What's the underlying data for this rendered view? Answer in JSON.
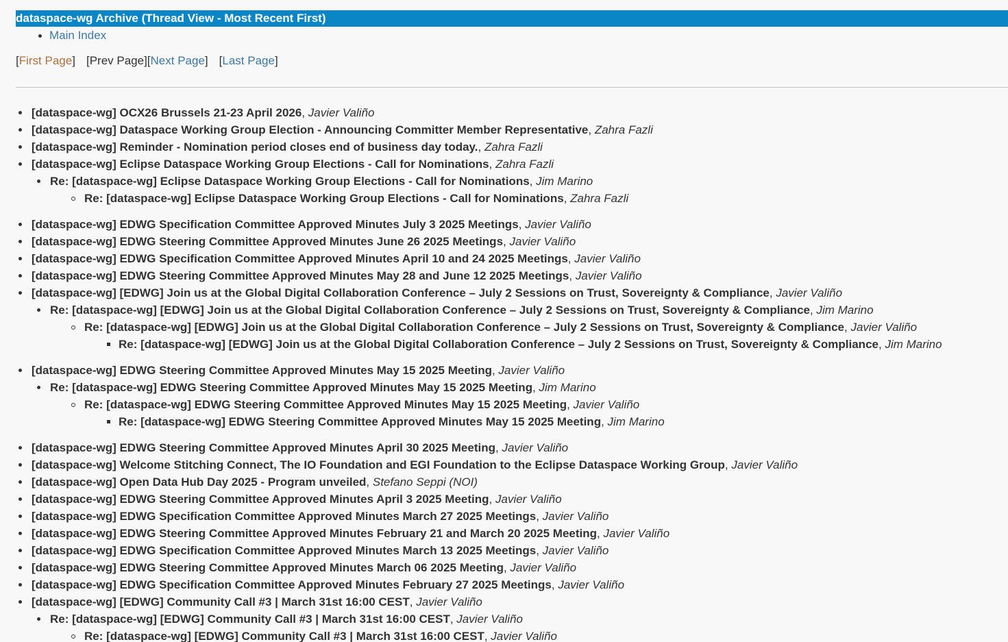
{
  "header": {
    "title": "dataspace-wg Archive (Thread View - Most Recent First)"
  },
  "nav": {
    "main_index": "Main Index"
  },
  "pager": {
    "first": "First Page",
    "prev": "Prev Page",
    "next": "Next Page",
    "last": "Last Page"
  },
  "threads": [
    {
      "depth": 0,
      "gap": false,
      "subject": "[dataspace-wg] OCX26 Brussels 21-23 April 2026",
      "author": "Javier Valiño"
    },
    {
      "depth": 0,
      "gap": false,
      "subject": "[dataspace-wg] Dataspace Working Group Election - Announcing Committer Member Representative",
      "author": "Zahra Fazli"
    },
    {
      "depth": 0,
      "gap": false,
      "subject": "[dataspace-wg] Reminder - Nomination period closes end of business day today.",
      "author": "Zahra Fazli"
    },
    {
      "depth": 0,
      "gap": false,
      "subject": "[dataspace-wg] Eclipse Dataspace Working Group Elections - Call for Nominations",
      "author": "Zahra Fazli"
    },
    {
      "depth": 1,
      "gap": false,
      "subject": "Re: [dataspace-wg] Eclipse Dataspace Working Group Elections - Call for Nominations",
      "author": "Jim Marino"
    },
    {
      "depth": 2,
      "gap": false,
      "subject": "Re: [dataspace-wg] Eclipse Dataspace Working Group Elections - Call for Nominations",
      "author": "Zahra Fazli"
    },
    {
      "depth": 0,
      "gap": true,
      "subject": "[dataspace-wg] EDWG Specification Committee Approved Minutes July 3 2025 Meetings",
      "author": "Javier Valiño"
    },
    {
      "depth": 0,
      "gap": false,
      "subject": "[dataspace-wg] EDWG Steering Committee Approved Minutes June 26 2025 Meetings",
      "author": "Javier Valiño"
    },
    {
      "depth": 0,
      "gap": false,
      "subject": "[dataspace-wg] EDWG Specification Committee Approved Minutes April 10 and 24 2025 Meetings",
      "author": "Javier Valiño"
    },
    {
      "depth": 0,
      "gap": false,
      "subject": "[dataspace-wg] EDWG Steering Committee Approved Minutes May 28 and June 12 2025 Meetings",
      "author": "Javier Valiño"
    },
    {
      "depth": 0,
      "gap": false,
      "subject": "[dataspace-wg] [EDWG] Join us at the Global Digital Collaboration Conference – July 2 Sessions on Trust, Sovereignty & Compliance",
      "author": "Javier Valiño"
    },
    {
      "depth": 1,
      "gap": false,
      "subject": "Re: [dataspace-wg] [EDWG] Join us at the Global Digital Collaboration Conference – July 2 Sessions on Trust, Sovereignty & Compliance",
      "author": "Jim Marino"
    },
    {
      "depth": 2,
      "gap": false,
      "subject": "Re: [dataspace-wg] [EDWG] Join us at the Global Digital Collaboration Conference – July 2 Sessions on Trust, Sovereignty & Compliance",
      "author": "Javier Valiño"
    },
    {
      "depth": 3,
      "gap": false,
      "subject": "Re: [dataspace-wg] [EDWG] Join us at the Global Digital Collaboration Conference – July 2 Sessions on Trust, Sovereignty & Compliance",
      "author": "Jim Marino"
    },
    {
      "depth": 0,
      "gap": true,
      "subject": "[dataspace-wg] EDWG Steering Committee Approved Minutes May 15 2025 Meeting",
      "author": "Javier Valiño"
    },
    {
      "depth": 1,
      "gap": false,
      "subject": "Re: [dataspace-wg] EDWG Steering Committee Approved Minutes May 15 2025 Meeting",
      "author": "Jim Marino"
    },
    {
      "depth": 2,
      "gap": false,
      "subject": "Re: [dataspace-wg] EDWG Steering Committee Approved Minutes May 15 2025 Meeting",
      "author": "Javier Valiño"
    },
    {
      "depth": 3,
      "gap": false,
      "subject": "Re: [dataspace-wg] EDWG Steering Committee Approved Minutes May 15 2025 Meeting",
      "author": "Jim Marino"
    },
    {
      "depth": 0,
      "gap": true,
      "subject": "[dataspace-wg] EDWG Steering Committee Approved Minutes April 30 2025 Meeting",
      "author": "Javier Valiño"
    },
    {
      "depth": 0,
      "gap": false,
      "subject": "[dataspace-wg] Welcome Stitching Connect, The IO Foundation and EGI Foundation to the Eclipse Dataspace Working Group",
      "author": "Javier Valiño"
    },
    {
      "depth": 0,
      "gap": false,
      "subject": "[dataspace-wg] Open Data Hub Day 2025 - Program unveiled",
      "author": "Stefano Seppi (NOI)"
    },
    {
      "depth": 0,
      "gap": false,
      "subject": "[dataspace-wg] EDWG Steering Committee Approved Minutes April 3 2025 Meeting",
      "author": "Javier Valiño"
    },
    {
      "depth": 0,
      "gap": false,
      "subject": "[dataspace-wg] EDWG Specification Committee Approved Minutes March 27 2025 Meetings",
      "author": "Javier Valiño"
    },
    {
      "depth": 0,
      "gap": false,
      "subject": "[dataspace-wg] EDWG Steering Committee Approved Minutes February 21 and March 20 2025 Meeting",
      "author": "Javier Valiño"
    },
    {
      "depth": 0,
      "gap": false,
      "subject": "[dataspace-wg] EDWG Specification Committee Approved Minutes March 13 2025 Meetings",
      "author": "Javier Valiño"
    },
    {
      "depth": 0,
      "gap": false,
      "subject": "[dataspace-wg] EDWG Steering Committee Approved Minutes March 06 2025 Meeting",
      "author": "Javier Valiño"
    },
    {
      "depth": 0,
      "gap": false,
      "subject": "[dataspace-wg] EDWG Specification Committee Approved Minutes February 27 2025 Meetings",
      "author": "Javier Valiño"
    },
    {
      "depth": 0,
      "gap": false,
      "subject": "[dataspace-wg] [EDWG] Community Call #3 | March 31st 16:00 CEST",
      "author": "Javier Valiño"
    },
    {
      "depth": 1,
      "gap": false,
      "subject": "Re: [dataspace-wg] [EDWG] Community Call #3 | March 31st 16:00 CEST",
      "author": "Javier Valiño"
    },
    {
      "depth": 2,
      "gap": false,
      "subject": "Re: [dataspace-wg] [EDWG] Community Call #3 | March 31st 16:00 CEST",
      "author": "Javier Valiño"
    }
  ]
}
